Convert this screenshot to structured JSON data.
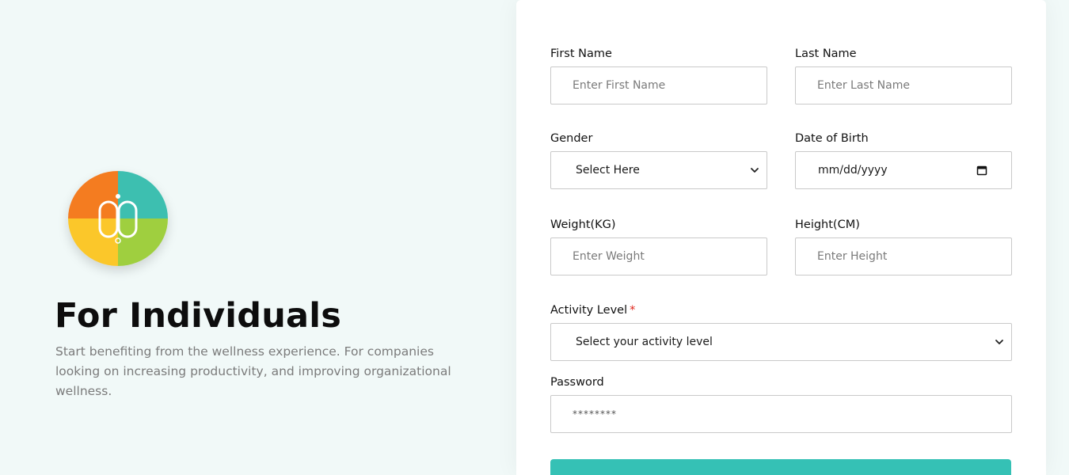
{
  "hero": {
    "title": "For Individuals",
    "description": "Start benefiting from the wellness experience. For companies looking on increasing productivity, and improving organizational wellness."
  },
  "form": {
    "first_name": {
      "label": "First Name",
      "placeholder": "Enter First Name"
    },
    "last_name": {
      "label": "Last Name",
      "placeholder": "Enter Last Name"
    },
    "gender": {
      "label": "Gender",
      "selected": "Select Here"
    },
    "dob": {
      "label": "Date of Birth",
      "value": "mm/dd/yyyy"
    },
    "weight": {
      "label": "Weight(KG)",
      "placeholder": "Enter Weight"
    },
    "height": {
      "label": "Height(CM)",
      "placeholder": "Enter Height"
    },
    "activity": {
      "label": "Activity Level",
      "required_mark": "*",
      "selected": "Select your activity level"
    },
    "password": {
      "label": "Password",
      "value": "********"
    }
  },
  "icons": {
    "logo": "wellness-logo-icon",
    "select_arrow": "chevron-down-icon",
    "calendar": "calendar-icon"
  },
  "colors": {
    "accent": "#35c1b5",
    "logo_orange": "#f47c20",
    "logo_teal": "#3dbfb0",
    "logo_yellow": "#fbc72a",
    "logo_green": "#9fcf3f",
    "required": "#e0251b",
    "page_background": "#f1f9f8"
  }
}
